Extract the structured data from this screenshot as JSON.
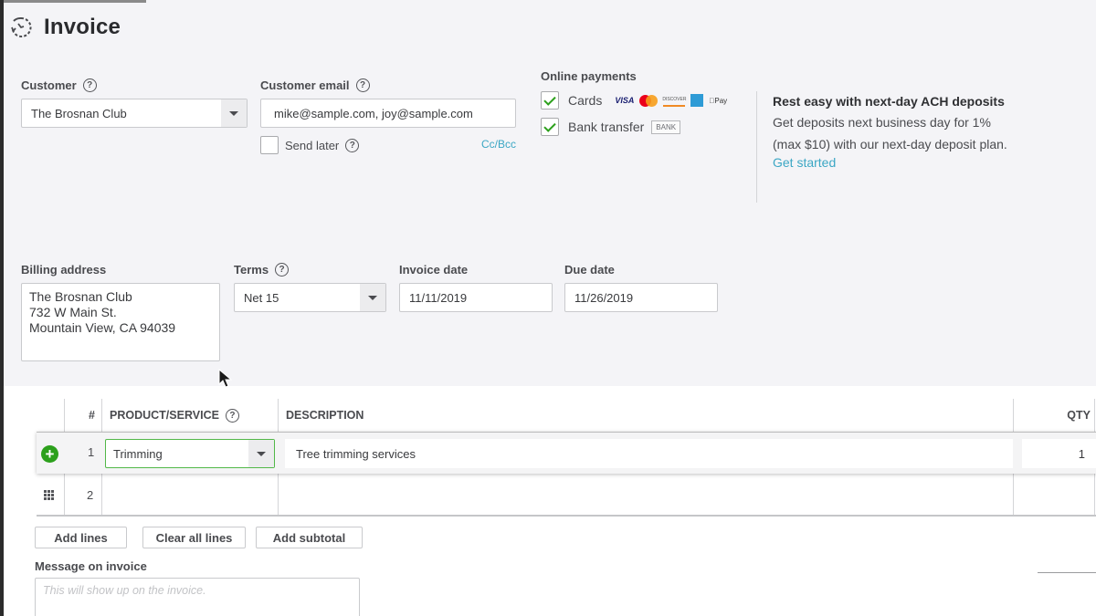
{
  "header": {
    "title": "Invoice",
    "icon": "recurring-clock-icon"
  },
  "customer": {
    "label": "Customer",
    "value": "The Brosnan Club"
  },
  "email": {
    "label": "Customer email",
    "value": "mike@sample.com, joy@sample.com",
    "send_later_label": "Send later",
    "send_later_checked": false,
    "cc_bcc_label": "Cc/Bcc"
  },
  "online_payments": {
    "label": "Online payments",
    "cards": {
      "label": "Cards",
      "checked": true,
      "logos": [
        "VISA",
        "mastercard",
        "DISCOVER",
        "amex",
        "Pay"
      ]
    },
    "bank": {
      "label": "Bank transfer",
      "checked": true,
      "badge": "BANK"
    }
  },
  "promo": {
    "title": "Rest easy with next-day ACH deposits",
    "body": "Get deposits next business day for 1% (max $10) with our next-day deposit plan.",
    "link": "Get started"
  },
  "billing": {
    "label": "Billing address",
    "lines": [
      "The Brosnan Club",
      "732 W Main St.",
      "Mountain View, CA 94039"
    ]
  },
  "terms": {
    "label": "Terms",
    "value": "Net 15"
  },
  "invoice_date": {
    "label": "Invoice date",
    "value": "11/11/2019"
  },
  "due_date": {
    "label": "Due date",
    "value": "11/26/2019"
  },
  "table": {
    "columns": [
      "#",
      "PRODUCT/SERVICE",
      "DESCRIPTION",
      "QTY"
    ],
    "rows": [
      {
        "num": "1",
        "product": "Trimming",
        "description": "Tree trimming services",
        "qty": "1"
      },
      {
        "num": "2",
        "product": "",
        "description": "",
        "qty": ""
      }
    ]
  },
  "buttons": {
    "add_lines": "Add lines",
    "clear_all": "Clear all lines",
    "add_subtotal": "Add subtotal"
  },
  "message": {
    "label": "Message on invoice",
    "placeholder": "This will show up on the invoice."
  }
}
